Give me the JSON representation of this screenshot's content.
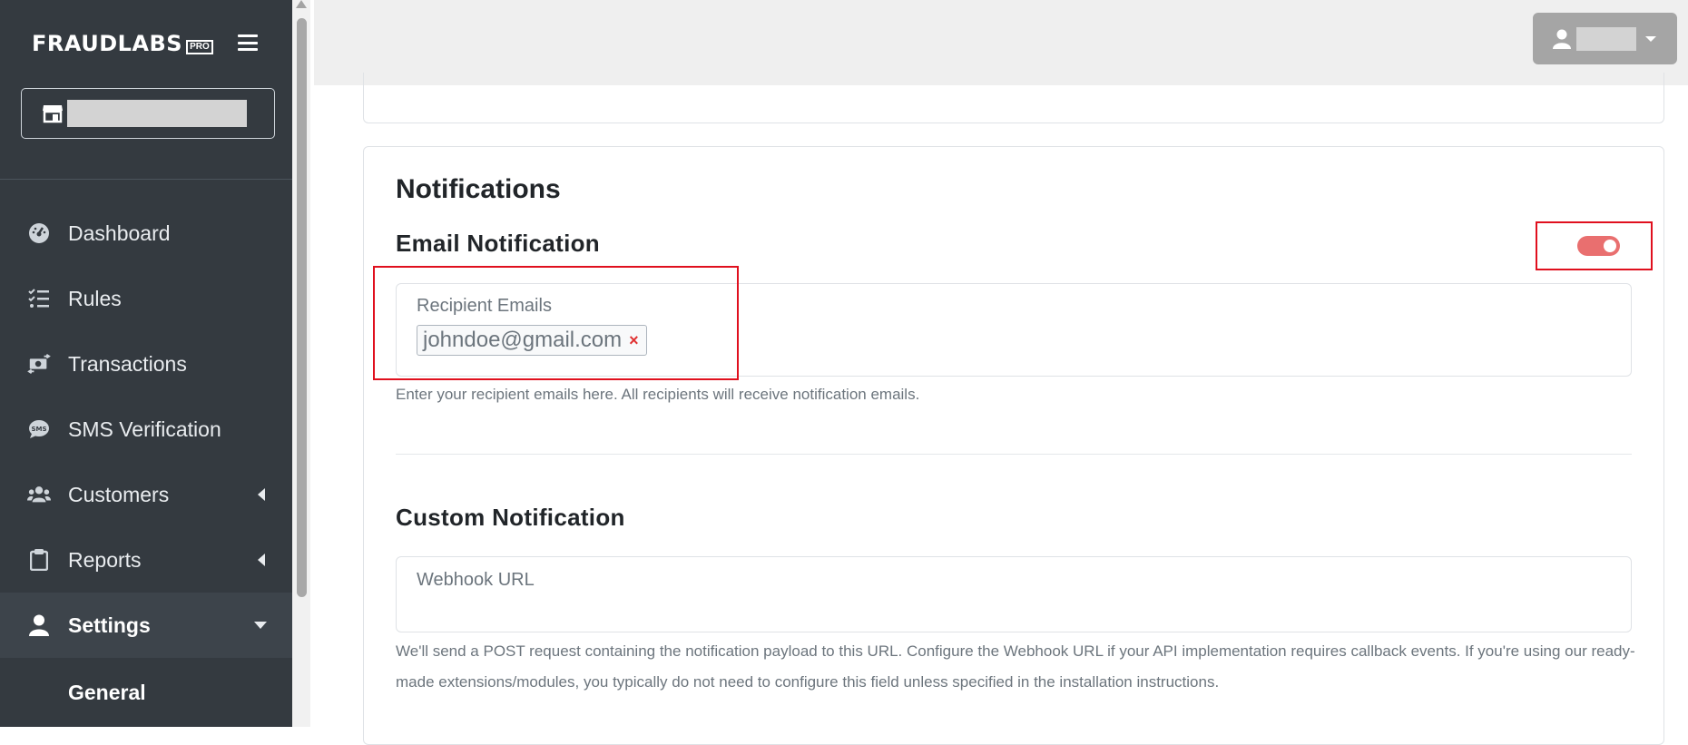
{
  "sidebar": {
    "brand": "FRAUDLABS",
    "brand_badge": "PRO",
    "store_icon": "store-icon",
    "items": [
      {
        "label": "Dashboard",
        "icon": "dashboard-gauge-icon"
      },
      {
        "label": "Rules",
        "icon": "checklist-icon"
      },
      {
        "label": "Transactions",
        "icon": "money-transfer-icon"
      },
      {
        "label": "SMS Verification",
        "icon": "sms-bubble-icon"
      },
      {
        "label": "Customers",
        "icon": "users-icon"
      },
      {
        "label": "Reports",
        "icon": "clipboard-icon"
      },
      {
        "label": "Settings",
        "icon": "user-icon"
      }
    ],
    "sub_item": "General"
  },
  "topbar": {
    "user_icon": "user-icon"
  },
  "main": {
    "section_title": "Notifications",
    "email": {
      "title": "Email Notification",
      "toggle_on": true,
      "field_label": "Recipient Emails",
      "tags": [
        "johndoe@gmail.com"
      ],
      "help": "Enter your recipient emails here. All recipients will receive notification emails."
    },
    "custom": {
      "title": "Custom Notification",
      "field_label": "Webhook URL",
      "help": "We'll send a POST request containing the notification payload to this URL. Configure the Webhook URL if your API implementation requires callback events. If you're using our ready-made extensions/modules, you typically do not need to configure this field unless specified in the installation instructions."
    }
  },
  "colors": {
    "sidebar_bg": "#343a40",
    "accent_toggle": "#e96f6f",
    "highlight_frame": "#e0101e"
  }
}
